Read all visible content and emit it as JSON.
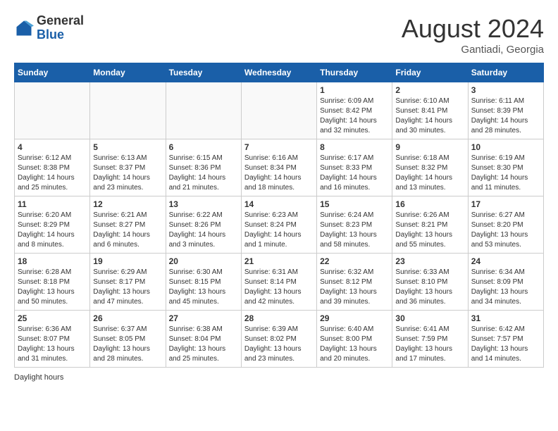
{
  "header": {
    "logo_general": "General",
    "logo_blue": "Blue",
    "month_title": "August 2024",
    "location": "Gantiadi, Georgia"
  },
  "days_of_week": [
    "Sunday",
    "Monday",
    "Tuesday",
    "Wednesday",
    "Thursday",
    "Friday",
    "Saturday"
  ],
  "footer": {
    "daylight_label": "Daylight hours"
  },
  "weeks": [
    [
      {
        "day": "",
        "info": ""
      },
      {
        "day": "",
        "info": ""
      },
      {
        "day": "",
        "info": ""
      },
      {
        "day": "",
        "info": ""
      },
      {
        "day": "1",
        "info": "Sunrise: 6:09 AM\nSunset: 8:42 PM\nDaylight: 14 hours\nand 32 minutes."
      },
      {
        "day": "2",
        "info": "Sunrise: 6:10 AM\nSunset: 8:41 PM\nDaylight: 14 hours\nand 30 minutes."
      },
      {
        "day": "3",
        "info": "Sunrise: 6:11 AM\nSunset: 8:39 PM\nDaylight: 14 hours\nand 28 minutes."
      }
    ],
    [
      {
        "day": "4",
        "info": "Sunrise: 6:12 AM\nSunset: 8:38 PM\nDaylight: 14 hours\nand 25 minutes."
      },
      {
        "day": "5",
        "info": "Sunrise: 6:13 AM\nSunset: 8:37 PM\nDaylight: 14 hours\nand 23 minutes."
      },
      {
        "day": "6",
        "info": "Sunrise: 6:15 AM\nSunset: 8:36 PM\nDaylight: 14 hours\nand 21 minutes."
      },
      {
        "day": "7",
        "info": "Sunrise: 6:16 AM\nSunset: 8:34 PM\nDaylight: 14 hours\nand 18 minutes."
      },
      {
        "day": "8",
        "info": "Sunrise: 6:17 AM\nSunset: 8:33 PM\nDaylight: 14 hours\nand 16 minutes."
      },
      {
        "day": "9",
        "info": "Sunrise: 6:18 AM\nSunset: 8:32 PM\nDaylight: 14 hours\nand 13 minutes."
      },
      {
        "day": "10",
        "info": "Sunrise: 6:19 AM\nSunset: 8:30 PM\nDaylight: 14 hours\nand 11 minutes."
      }
    ],
    [
      {
        "day": "11",
        "info": "Sunrise: 6:20 AM\nSunset: 8:29 PM\nDaylight: 14 hours\nand 8 minutes."
      },
      {
        "day": "12",
        "info": "Sunrise: 6:21 AM\nSunset: 8:27 PM\nDaylight: 14 hours\nand 6 minutes."
      },
      {
        "day": "13",
        "info": "Sunrise: 6:22 AM\nSunset: 8:26 PM\nDaylight: 14 hours\nand 3 minutes."
      },
      {
        "day": "14",
        "info": "Sunrise: 6:23 AM\nSunset: 8:24 PM\nDaylight: 14 hours\nand 1 minute."
      },
      {
        "day": "15",
        "info": "Sunrise: 6:24 AM\nSunset: 8:23 PM\nDaylight: 13 hours\nand 58 minutes."
      },
      {
        "day": "16",
        "info": "Sunrise: 6:26 AM\nSunset: 8:21 PM\nDaylight: 13 hours\nand 55 minutes."
      },
      {
        "day": "17",
        "info": "Sunrise: 6:27 AM\nSunset: 8:20 PM\nDaylight: 13 hours\nand 53 minutes."
      }
    ],
    [
      {
        "day": "18",
        "info": "Sunrise: 6:28 AM\nSunset: 8:18 PM\nDaylight: 13 hours\nand 50 minutes."
      },
      {
        "day": "19",
        "info": "Sunrise: 6:29 AM\nSunset: 8:17 PM\nDaylight: 13 hours\nand 47 minutes."
      },
      {
        "day": "20",
        "info": "Sunrise: 6:30 AM\nSunset: 8:15 PM\nDaylight: 13 hours\nand 45 minutes."
      },
      {
        "day": "21",
        "info": "Sunrise: 6:31 AM\nSunset: 8:14 PM\nDaylight: 13 hours\nand 42 minutes."
      },
      {
        "day": "22",
        "info": "Sunrise: 6:32 AM\nSunset: 8:12 PM\nDaylight: 13 hours\nand 39 minutes."
      },
      {
        "day": "23",
        "info": "Sunrise: 6:33 AM\nSunset: 8:10 PM\nDaylight: 13 hours\nand 36 minutes."
      },
      {
        "day": "24",
        "info": "Sunrise: 6:34 AM\nSunset: 8:09 PM\nDaylight: 13 hours\nand 34 minutes."
      }
    ],
    [
      {
        "day": "25",
        "info": "Sunrise: 6:36 AM\nSunset: 8:07 PM\nDaylight: 13 hours\nand 31 minutes."
      },
      {
        "day": "26",
        "info": "Sunrise: 6:37 AM\nSunset: 8:05 PM\nDaylight: 13 hours\nand 28 minutes."
      },
      {
        "day": "27",
        "info": "Sunrise: 6:38 AM\nSunset: 8:04 PM\nDaylight: 13 hours\nand 25 minutes."
      },
      {
        "day": "28",
        "info": "Sunrise: 6:39 AM\nSunset: 8:02 PM\nDaylight: 13 hours\nand 23 minutes."
      },
      {
        "day": "29",
        "info": "Sunrise: 6:40 AM\nSunset: 8:00 PM\nDaylight: 13 hours\nand 20 minutes."
      },
      {
        "day": "30",
        "info": "Sunrise: 6:41 AM\nSunset: 7:59 PM\nDaylight: 13 hours\nand 17 minutes."
      },
      {
        "day": "31",
        "info": "Sunrise: 6:42 AM\nSunset: 7:57 PM\nDaylight: 13 hours\nand 14 minutes."
      }
    ]
  ]
}
